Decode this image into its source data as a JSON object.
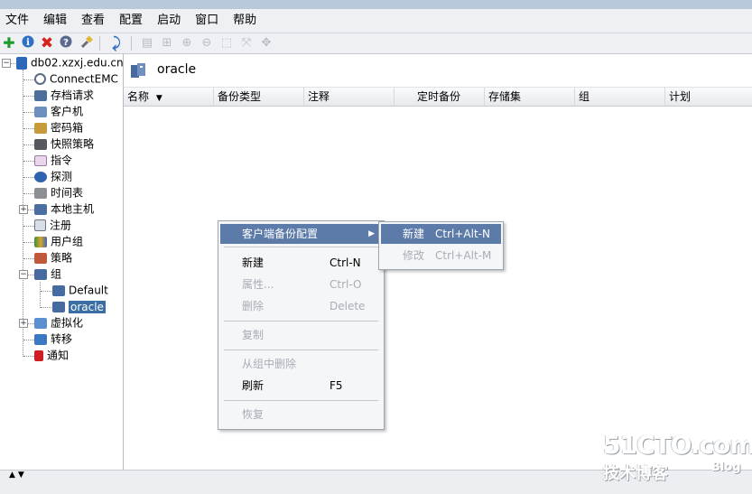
{
  "menubar": {
    "items": [
      "文件",
      "编辑",
      "查看",
      "配置",
      "启动",
      "窗口",
      "帮助"
    ]
  },
  "toolbar": {
    "icons": [
      "add-icon",
      "info-icon",
      "delete-icon",
      "help-icon",
      "wrench-icon",
      "refresh-icon",
      "table-view-icon",
      "tree-view-icon",
      "zoom-in-icon",
      "zoom-out-icon",
      "zoom-fit-icon",
      "layout-icon",
      "move-icon"
    ]
  },
  "tree": {
    "root": "db02.xzxj.edu.cn",
    "items": [
      "ConnectEMC",
      "存档请求",
      "客户机",
      "密码箱",
      "快照策略",
      "指令",
      "探测",
      "时间表",
      "本地主机",
      "注册",
      "用户组",
      "策略",
      "组",
      "虚拟化",
      "转移",
      "通知"
    ],
    "group_children": [
      "Default",
      "oracle"
    ]
  },
  "header": {
    "title": "oracle"
  },
  "columns": [
    "名称",
    "备份类型",
    "注释",
    "定时备份",
    "存储集",
    "组",
    "计划"
  ],
  "context_menu": {
    "client_backup_config": "客户端备份配置",
    "new_label": "新建",
    "new_shortcut": "Ctrl-N",
    "properties_label": "属性...",
    "properties_shortcut": "Ctrl-O",
    "delete_label": "删除",
    "delete_shortcut": "Delete",
    "copy_label": "复制",
    "remove_from_group_label": "从组中删除",
    "refresh_label": "刷新",
    "refresh_shortcut": "F5",
    "restore_label": "恢复"
  },
  "submenu": {
    "new_label": "新建",
    "new_shortcut": "Ctrl+Alt-N",
    "modify_label": "修改",
    "modify_shortcut": "Ctrl+Alt-M"
  },
  "watermark": {
    "main": "51CTO.com",
    "sub": "技术博客",
    "blog": "Blog"
  },
  "colors": {
    "selection": "#3a6ea5",
    "menu_highlight": "#5d7ba8",
    "disabled": "#a7adb5"
  }
}
